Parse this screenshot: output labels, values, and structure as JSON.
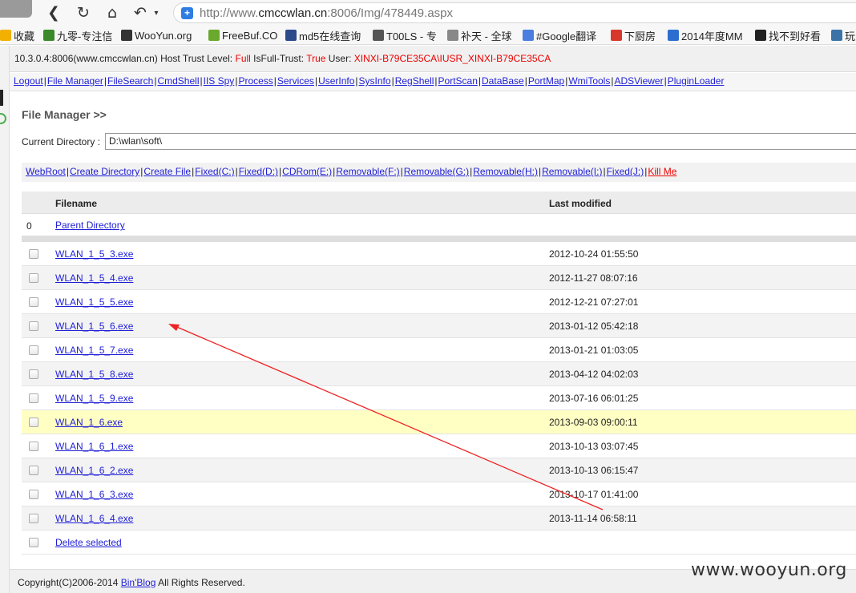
{
  "browser": {
    "url_prefix": "http://www.",
    "url_domain": "cmccwlan.cn",
    "url_rest": ":8006/Img/478449.aspx",
    "bookmarks": [
      {
        "label": "收藏",
        "icon": "star-icon",
        "color": "#f2b100"
      },
      {
        "label": "九零-专注信",
        "icon": "figure-icon",
        "color": "#3a8a2a"
      },
      {
        "label": "WooYun.org",
        "icon": "wooyun-icon",
        "color": "#333333"
      },
      {
        "label": "FreeBuf.CO",
        "icon": "freebuf-icon",
        "color": "#6aa82e"
      },
      {
        "label": "md5在线查询",
        "icon": "grid-icon",
        "color": "#2b4a8a"
      },
      {
        "label": "T00LS - 专",
        "icon": "tools-icon",
        "color": "#555555"
      },
      {
        "label": "补天 - 全球",
        "icon": "butian-icon",
        "color": "#888888"
      },
      {
        "label": "#Google翻译",
        "icon": "translate-icon",
        "color": "#4a7de0"
      },
      {
        "label": "下厨房",
        "icon": "kitchen-icon",
        "color": "#d8382c"
      },
      {
        "label": "2014年度MM",
        "icon": "circle-play-icon",
        "color": "#2a6fd0"
      },
      {
        "label": "找不到好看",
        "icon": "w-icon",
        "color": "#222222"
      },
      {
        "label": "玩",
        "icon": "python-icon",
        "color": "#3b73a8"
      }
    ]
  },
  "info": {
    "host": "10.3.0.4:8006(www.cmccwlan.cn)",
    "trust_label": "Host Trust Level:",
    "trust_value": "Full",
    "isfull_label": "IsFull-Trust:",
    "isfull_value": "True",
    "user_label": "User:",
    "user_value": "XINXI-B79CE35CA\\IUSR_XINXI-B79CE35CA"
  },
  "nav": [
    "Logout",
    "File Manager",
    "FileSearch",
    "CmdShell",
    "IIS Spy",
    "Process",
    "Services",
    "UserInfo",
    "SysInfo",
    "RegShell",
    "PortScan",
    "DataBase",
    "PortMap",
    "WmiTools",
    "ADSViewer",
    "PluginLoader"
  ],
  "page": {
    "title": "File Manager >>",
    "current_dir_label": "Current Directory :",
    "current_dir_value": "D:\\wlan\\soft\\"
  },
  "drives": [
    "WebRoot",
    "Create Directory",
    "Create File",
    "Fixed(C:)",
    "Fixed(D:)",
    "CDRom(E:)",
    "Removable(F:)",
    "Removable(G:)",
    "Removable(H:)",
    "Removable(I:)",
    "Fixed(J:)"
  ],
  "kill_label": "Kill Me",
  "table": {
    "col_filename": "Filename",
    "col_modified": "Last modified",
    "parent_num": "0",
    "parent_label": "Parent Directory",
    "rows": [
      {
        "name": "WLAN_1_5_3.exe",
        "modified": "2012-10-24 01:55:50"
      },
      {
        "name": "WLAN_1_5_4.exe",
        "modified": "2012-11-27 08:07:16"
      },
      {
        "name": "WLAN_1_5_5.exe",
        "modified": "2012-12-21 07:27:01"
      },
      {
        "name": "WLAN_1_5_6.exe",
        "modified": "2013-01-12 05:42:18"
      },
      {
        "name": "WLAN_1_5_7.exe",
        "modified": "2013-01-21 01:03:05"
      },
      {
        "name": "WLAN_1_5_8.exe",
        "modified": "2013-04-12 04:02:03"
      },
      {
        "name": "WLAN_1_5_9.exe",
        "modified": "2013-07-16 06:01:25"
      },
      {
        "name": "WLAN_1_6.exe",
        "modified": "2013-09-03 09:00:11"
      },
      {
        "name": "WLAN_1_6_1.exe",
        "modified": "2013-10-13 03:07:45"
      },
      {
        "name": "WLAN_1_6_2.exe",
        "modified": "2013-10-13 06:15:47"
      },
      {
        "name": "WLAN_1_6_3.exe",
        "modified": "2013-10-17 01:41:00"
      },
      {
        "name": "WLAN_1_6_4.exe",
        "modified": "2013-11-14 06:58:11"
      }
    ],
    "highlight_row": 7,
    "delete_label": "Delete selected"
  },
  "footer": {
    "prefix": "Copyright(C)2006-2014",
    "link": "Bin'Blog",
    "suffix": "All Rights Reserved."
  },
  "watermark": "www.wooyun.org",
  "colors": {
    "link": "#1f1fd6",
    "alert": "#ee0000",
    "highlight_row": "#ffffc4",
    "arrow": "#ee2222"
  }
}
